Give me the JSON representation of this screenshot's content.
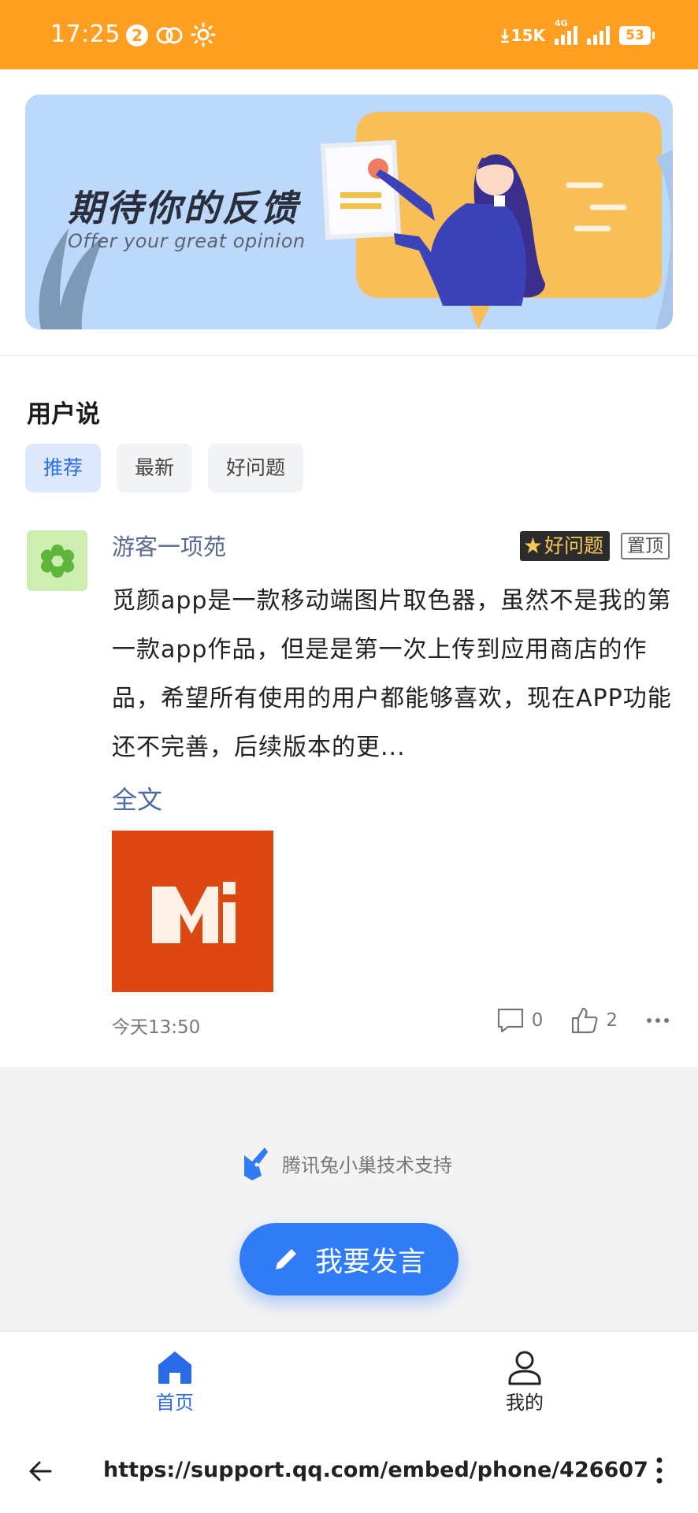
{
  "status_bar": {
    "time": "17:25",
    "notification_count": "2",
    "net_speed": "15K",
    "network_type": "4G",
    "battery": "53"
  },
  "banner": {
    "title": "期待你的反馈",
    "subtitle": "Offer your great opinion"
  },
  "section": {
    "title": "用户说"
  },
  "tabs": [
    {
      "label": "推荐"
    },
    {
      "label": "最新"
    },
    {
      "label": "好问题"
    }
  ],
  "post": {
    "author": "游客一项苑",
    "tag_good": "好问题",
    "tag_pinned": "置顶",
    "body": "觅颜app是一款移动端图片取色器，虽然不是我的第一款app作品，但是是第一次上传到应用商店的作品，希望所有使用的用户都能够喜欢，现在APP功能还不完善，后续版本的更...",
    "read_more": "全文",
    "image_letter": "Mi",
    "time": "今天13:50",
    "comments": "0",
    "likes": "2"
  },
  "support_text": "腾讯兔小巢技术支持",
  "fab_label": "我要发言",
  "bottom_nav": {
    "home": "首页",
    "mine": "我的"
  },
  "browser": {
    "url": "https://support.qq.com/embed/phone/426607"
  },
  "colors": {
    "status_bar": "#ff9f22",
    "accent_blue": "#2f7cf6",
    "tab_active_bg": "#dde8fd",
    "post_image_bg": "#dd4812"
  }
}
